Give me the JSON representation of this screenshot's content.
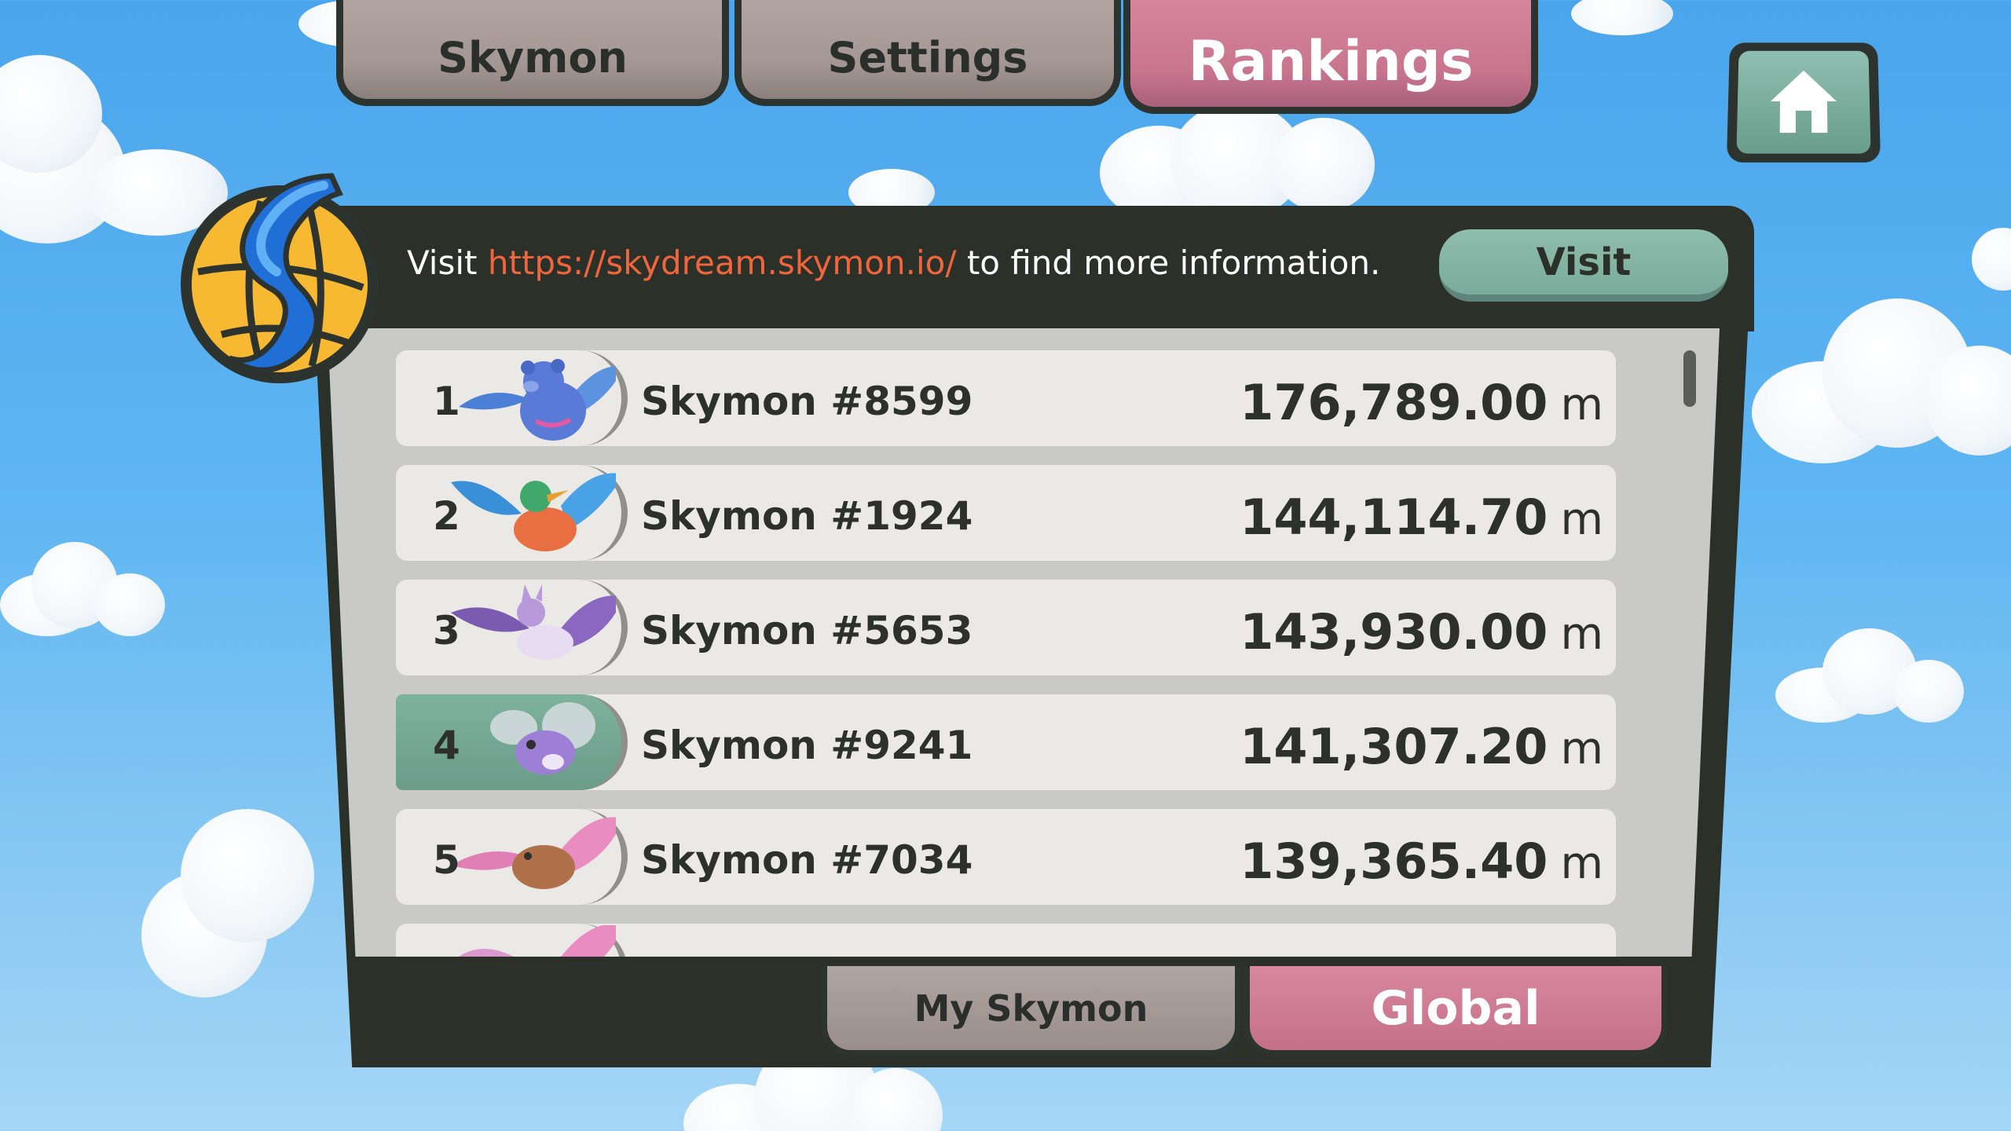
{
  "tabs": {
    "skymon": "Skymon",
    "settings": "Settings",
    "rankings": "Rankings"
  },
  "info": {
    "prefix": "Visit ",
    "link": "https://skydream.skymon.io/",
    "suffix": " to find more information.",
    "visit_button": "Visit"
  },
  "rankings": [
    {
      "rank": "1",
      "name": "Skymon #8599",
      "score": "176,789.00",
      "unit": "m",
      "creature": "blue-bear-bird"
    },
    {
      "rank": "2",
      "name": "Skymon #1924",
      "score": "144,114.70",
      "unit": "m",
      "creature": "orange-duck-bird"
    },
    {
      "rank": "3",
      "name": "Skymon #5653",
      "score": "143,930.00",
      "unit": "m",
      "creature": "purple-bat"
    },
    {
      "rank": "4",
      "name": "Skymon #9241",
      "score": "141,307.20",
      "unit": "m",
      "creature": "purple-hamster-fly"
    },
    {
      "rank": "5",
      "name": "Skymon #7034",
      "score": "139,365.40",
      "unit": "m",
      "creature": "brown-capybara-pink-wings"
    }
  ],
  "bottom_tabs": {
    "my_skymon": "My Skymon",
    "global": "Global"
  },
  "colors": {
    "accent_pink": "#c97590",
    "accent_green": "#7aab9b",
    "panel_dark": "#2b3029",
    "link": "#f0653b"
  }
}
